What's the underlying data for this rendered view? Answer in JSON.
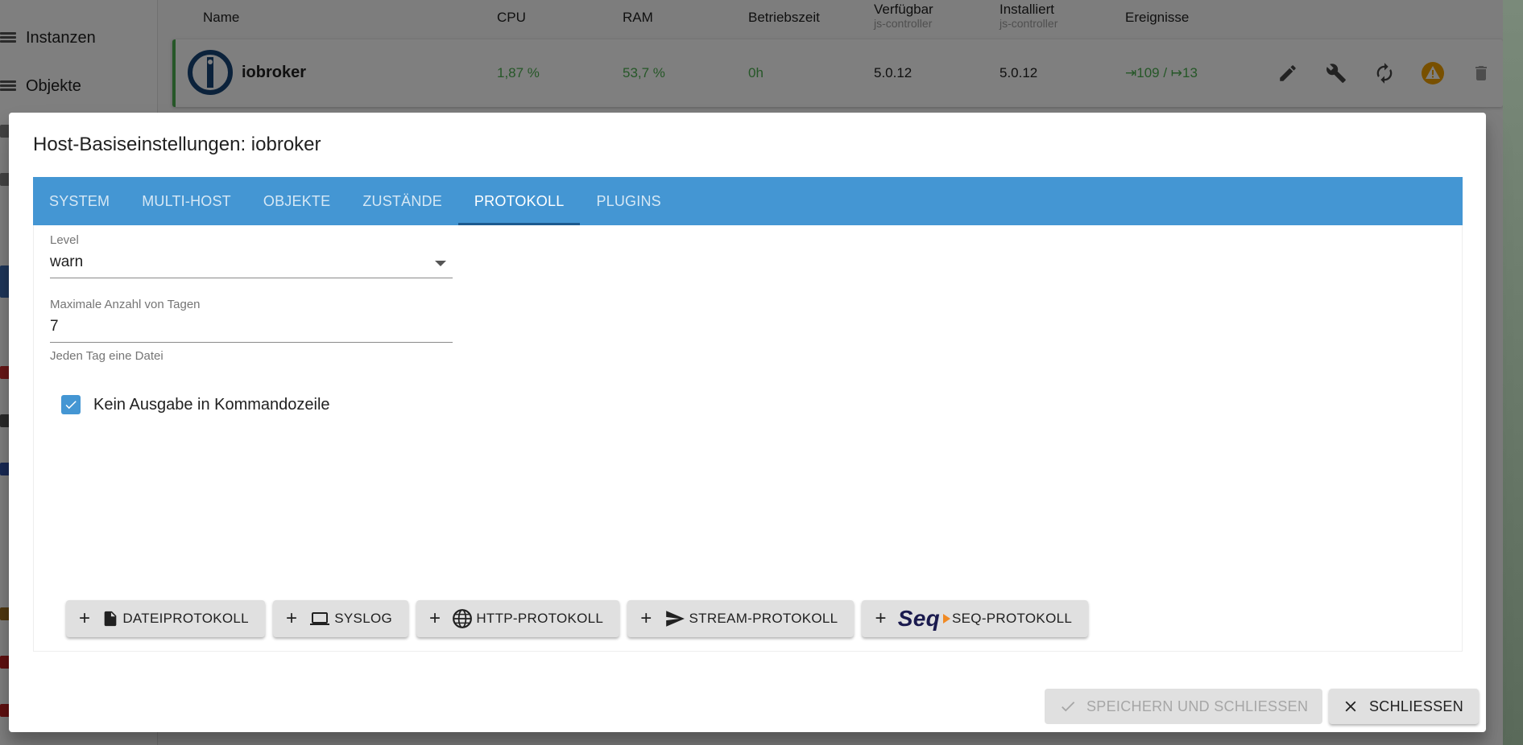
{
  "sidebar": {
    "items": [
      {
        "label": "Instanzen",
        "icon": "list-icon"
      },
      {
        "label": "Objekte",
        "icon": "list-icon"
      }
    ]
  },
  "hosts_table": {
    "columns": {
      "name": "Name",
      "cpu": "CPU",
      "ram": "RAM",
      "uptime": "Betriebszeit",
      "available": "Verfügbar",
      "available_sub": "js-controller",
      "installed": "Installiert",
      "installed_sub": "js-controller",
      "events": "Ereignisse"
    },
    "row": {
      "name": "iobroker",
      "cpu": "1,87 %",
      "ram": "53,7 %",
      "uptime": "0h",
      "available": "5.0.12",
      "installed": "5.0.12",
      "events": "⇥109 / ↦13",
      "status_color": "#4caf50"
    }
  },
  "dialog": {
    "title": "Host-Basiseinstellungen: iobroker",
    "tabs": [
      {
        "label": "SYSTEM",
        "active": false
      },
      {
        "label": "MULTI-HOST",
        "active": false
      },
      {
        "label": "OBJEKTE",
        "active": false
      },
      {
        "label": "ZUSTÄNDE",
        "active": false
      },
      {
        "label": "PROTOKOLL",
        "active": true
      },
      {
        "label": "PLUGINS",
        "active": false
      }
    ],
    "level": {
      "label": "Level",
      "value": "warn"
    },
    "max_days": {
      "label": "Maximale Anzahl von Tagen",
      "value": "7",
      "helper": "Jeden Tag eine Datei"
    },
    "no_stdout": {
      "label": "Kein Ausgabe in Kommandozeile",
      "checked": true
    },
    "add_buttons": [
      {
        "label": "DATEIPROTOKOLL",
        "icon": "file-icon"
      },
      {
        "label": "SYSLOG",
        "icon": "laptop-icon"
      },
      {
        "label": "HTTP-PROTOKOLL",
        "icon": "globe-icon"
      },
      {
        "label": "STREAM-PROTOKOLL",
        "icon": "send-icon"
      },
      {
        "label": "SEQ-PROTOKOLL",
        "icon": "seq-logo-icon",
        "logo_text": "Seq"
      }
    ],
    "footer": {
      "save_label": "SPEICHERN UND SCHLIESSEN",
      "close_label": "SCHLIESSEN"
    }
  },
  "colors": {
    "tab_bar": "#4496d3",
    "checkbox": "#4496d3",
    "warning_icon": "#f0a000"
  }
}
